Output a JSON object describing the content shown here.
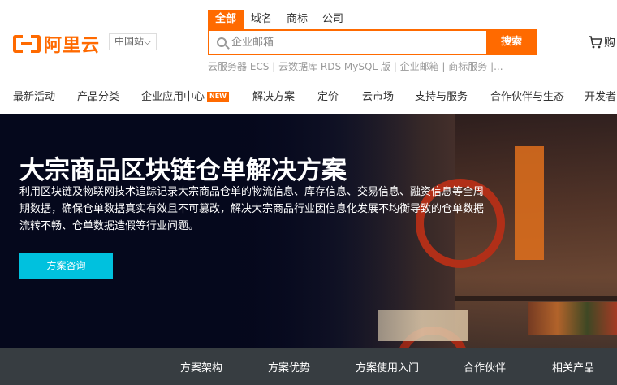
{
  "logo": {
    "text": "阿里云",
    "brand_color": "#ff6a00"
  },
  "region": {
    "label": "中国站⌵"
  },
  "search": {
    "tabs": [
      "全部",
      "域名",
      "商标",
      "公司"
    ],
    "active_tab": 0,
    "placeholder": "企业邮箱",
    "button_label": "搜索",
    "hotwords": "云服务器 ECS | 云数据库 RDS MySQL 版 | 企业邮箱 | 商标服务 |..."
  },
  "cart": {
    "label": "购"
  },
  "nav": {
    "items": [
      "最新活动",
      "产品分类",
      "企业应用中心",
      "解决方案",
      "定价",
      "云市场",
      "支持与服务",
      "合作伙伴与生态",
      "开发者"
    ],
    "badge": "NEW"
  },
  "hero": {
    "title": "大宗商品区块链仓单解决方案",
    "description": "利用区块链及物联网技术追踪记录大宗商品仓单的物流信息、库存信息、交易信息、融资信息等全周期数据，确保仓单数据真实有效且不可篡改，解决大宗商品行业因信息化发展不均衡导致的仓单数据流转不畅、仓单数据造假等行业问题。",
    "button_label": "方案咨询",
    "button_color": "#00c1de"
  },
  "subnav": {
    "items": [
      "方案架构",
      "方案优势",
      "方案使用入门",
      "合作伙伴",
      "相关产品"
    ]
  }
}
